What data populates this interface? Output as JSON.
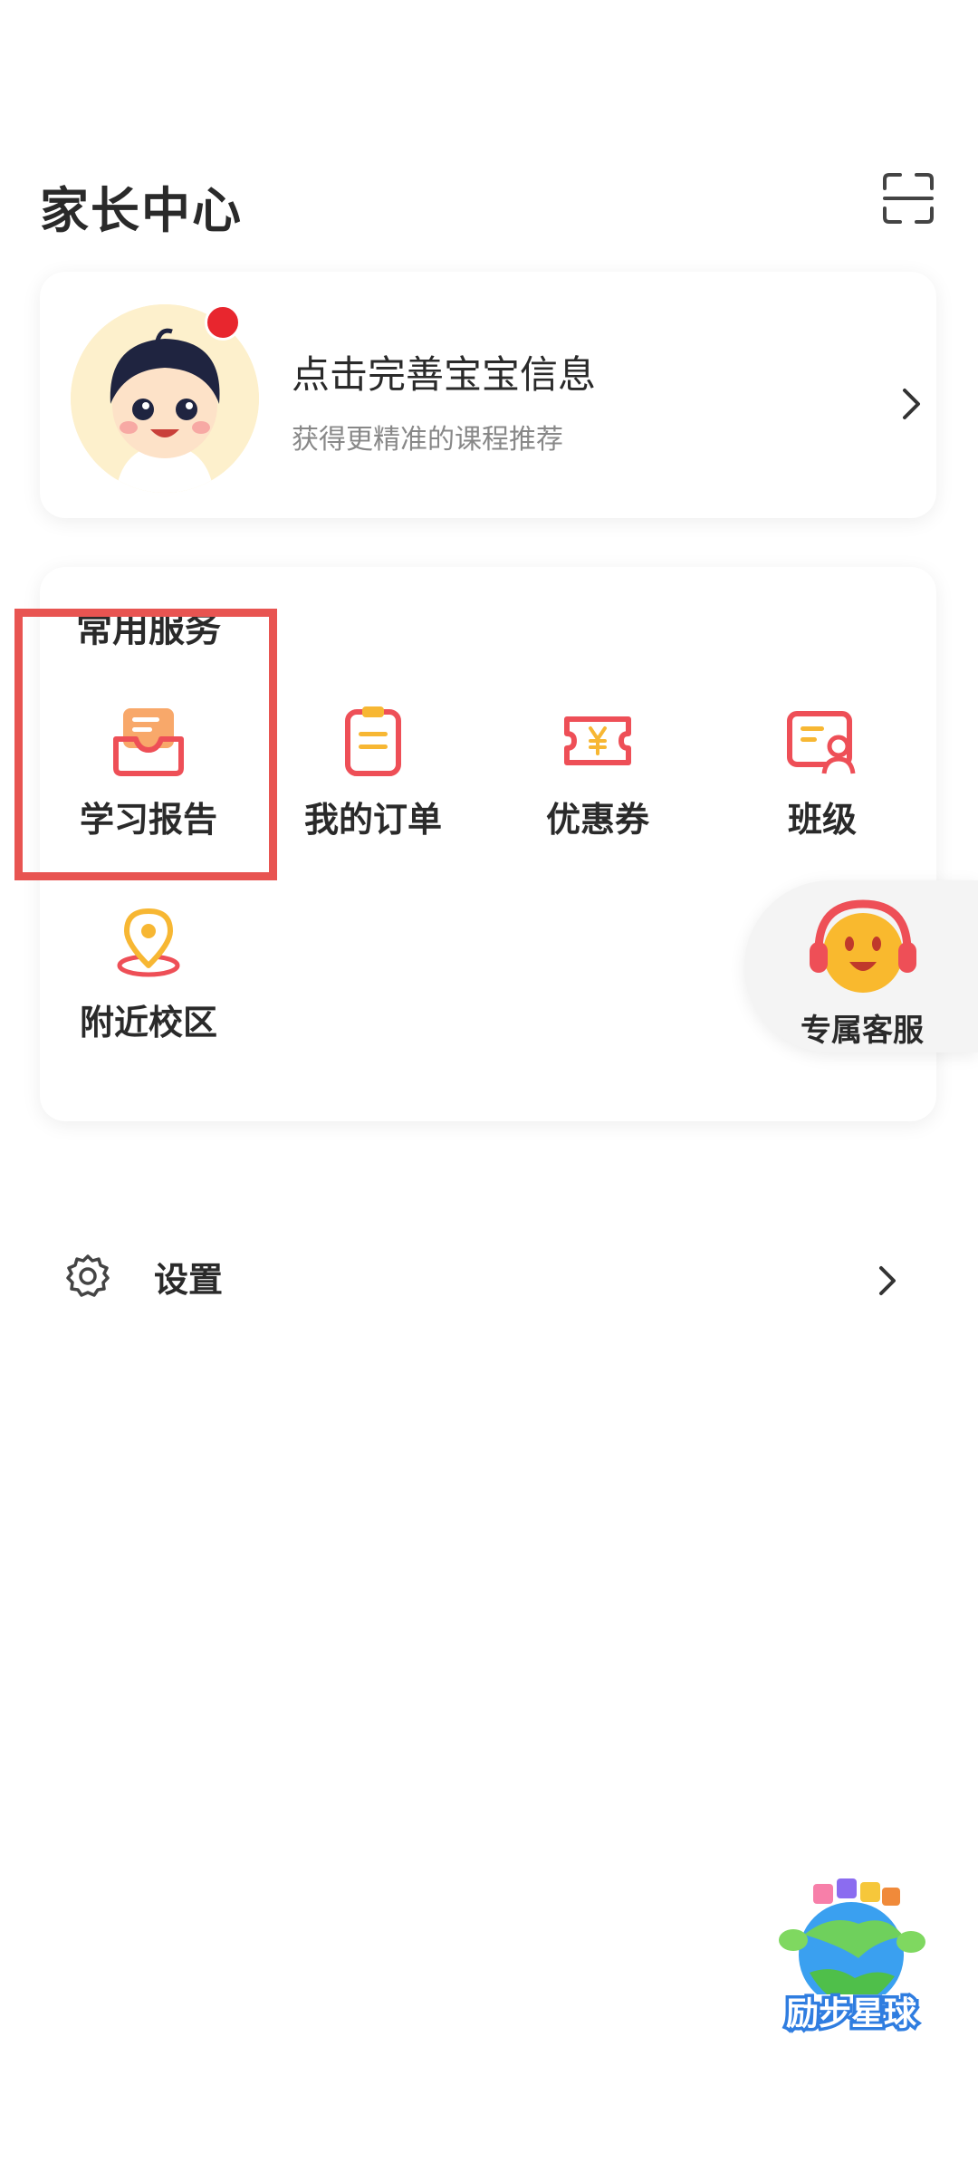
{
  "header": {
    "title": "家长中心",
    "scan_icon": "scan-icon"
  },
  "profile": {
    "title": "点击完善宝宝信息",
    "subtitle": "获得更精准的课程推荐",
    "avatar_icon": "child-avatar",
    "badge_color": "#e8262e"
  },
  "services": {
    "title": "常用服务",
    "items": [
      {
        "label": "学习报告",
        "icon": "report-tray-icon"
      },
      {
        "label": "我的订单",
        "icon": "order-clipboard-icon"
      },
      {
        "label": "优惠券",
        "icon": "coupon-yen-icon"
      },
      {
        "label": "班级",
        "icon": "class-card-icon"
      },
      {
        "label": "附近校区",
        "icon": "location-pin-icon"
      }
    ]
  },
  "customer_service": {
    "label": "专属客服",
    "icon": "headset-smiley-icon"
  },
  "settings": {
    "label": "设置",
    "icon": "gear-icon"
  },
  "floating_widget": {
    "label": "励步星球",
    "icon": "planet-icon"
  },
  "colors": {
    "accent_orange": "#f36b4e",
    "accent_yellow": "#f7b733",
    "highlight_red": "#e85451"
  }
}
